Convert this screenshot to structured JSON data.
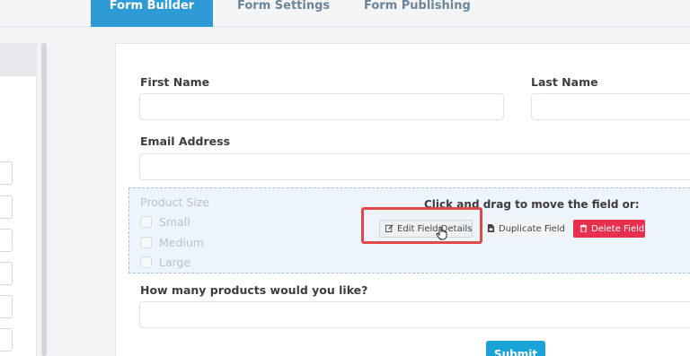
{
  "tabs": [
    {
      "label": "Form Builder",
      "active": true
    },
    {
      "label": "Form Settings",
      "active": false
    },
    {
      "label": "Form Publishing",
      "active": false
    }
  ],
  "form": {
    "first_name_label": "First Name",
    "last_name_label": "Last Name",
    "email_label": "Email Address",
    "product_size": {
      "label": "Product Size",
      "options": [
        "Small",
        "Medium",
        "Large"
      ]
    },
    "products_question": "How many products would you like?",
    "submit_label": "Submit"
  },
  "field_actions": {
    "hint": "Click and drag to move the field or:",
    "edit_label": "Edit Field Details",
    "duplicate_label": "Duplicate Field",
    "delete_label": "Delete Field"
  },
  "colors": {
    "accent": "#2f9bd6",
    "danger": "#e8304e",
    "highlight": "#e24a4a",
    "submit": "#19a3d8"
  }
}
